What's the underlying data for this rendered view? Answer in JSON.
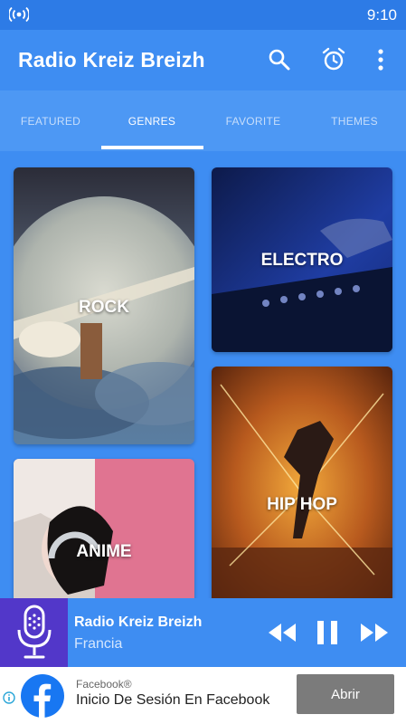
{
  "status_bar": {
    "time": "9:10",
    "cast_icon": "wireless-broadcast-icon"
  },
  "app_bar": {
    "title": "Radio Kreiz Breizh",
    "icons": [
      "search-icon",
      "alarm-clock-icon",
      "more-vert-icon"
    ]
  },
  "tabs": [
    {
      "label": "FEATURED",
      "active": false
    },
    {
      "label": "GENRES",
      "active": true
    },
    {
      "label": "FAVORITE",
      "active": false
    },
    {
      "label": "THEMES",
      "active": false
    }
  ],
  "genres": [
    {
      "label": "ROCK"
    },
    {
      "label": "ELECTRO"
    },
    {
      "label": "HIP HOP"
    },
    {
      "label": "ANIME"
    }
  ],
  "player": {
    "station": "Radio Kreiz Breizh",
    "country": "Francia",
    "cover_icon": "microphone-icon",
    "controls": [
      "rewind-icon",
      "pause-icon",
      "fast-forward-icon"
    ]
  },
  "ad": {
    "sponsor": "Facebook®",
    "headline": "Inicio De Sesión En Facebook",
    "cta": "Abrir",
    "logo": "facebook-logo-icon"
  },
  "colors": {
    "primary": "#3e8df2",
    "status_bar": "#2d7be6",
    "tab_bar": "#4d98f4",
    "cover_bg": "#5237c9",
    "facebook_blue": "#1877f2",
    "cta_bg": "#7b7b7b"
  }
}
